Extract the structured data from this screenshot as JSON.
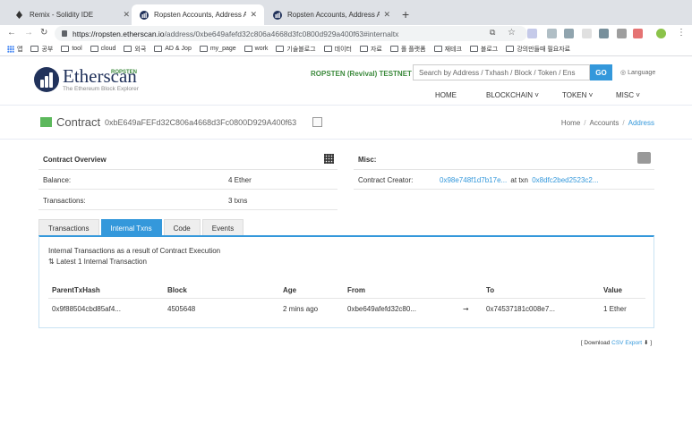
{
  "browser": {
    "tabs": [
      {
        "title": "Remix - Solidity IDE",
        "active": false
      },
      {
        "title": "Ropsten Accounts, Address Ac",
        "active": true
      },
      {
        "title": "Ropsten Accounts, Address Ac",
        "active": false
      }
    ],
    "url_host": "https://ropsten.etherscan.io",
    "url_path": "/address/0xbe649afefd32c806a4668d3fc0800d929a400f63#internaltx",
    "bookmarks": [
      "앱",
      "공부",
      "tool",
      "cloud",
      "외국",
      "AD & Jop",
      "my_page",
      "work",
      "기술블로그",
      "데이터",
      "자료",
      "폴 플랫폼",
      "재테크",
      "블로그",
      "강의만들때 필요자료"
    ]
  },
  "header": {
    "logo_name": "Etherscan",
    "logo_sub": "The Ethereum Block Explorer",
    "logo_network": "ROPSTEN",
    "testnet_label": "ROPSTEN (Revival) TESTNET",
    "search_placeholder": "Search by Address / Txhash / Block / Token / Ens",
    "go_label": "GO",
    "language_label": "Language",
    "menu": [
      "HOME",
      "BLOCKCHAIN ˅",
      "TOKEN ˅",
      "MISC ˅"
    ]
  },
  "page": {
    "title": "Contract",
    "address": "0xbE649aFEFd32C806a4668d3Fc0800D929A400f63",
    "breadcrumb": [
      "Home",
      "Accounts",
      "Address"
    ]
  },
  "overview": {
    "title": "Contract Overview",
    "balance_label": "Balance:",
    "balance_value": "4 Ether",
    "transactions_label": "Transactions:",
    "transactions_value": "3 txns"
  },
  "misc": {
    "title": "Misc:",
    "creator_label": "Contract Creator:",
    "creator_address": "0x98e748f1d7b17e...",
    "at_txn": "at txn",
    "creator_txn": "0x8dfc2bed2523c2..."
  },
  "tabs": [
    "Transactions",
    "Internal Txns",
    "Code",
    "Events"
  ],
  "internal": {
    "note": "Internal Transactions as a result of Contract Execution",
    "latest": "Latest 1 Internal Transaction",
    "columns": [
      "ParentTxHash",
      "Block",
      "Age",
      "From",
      "",
      "To",
      "Value"
    ],
    "rows": [
      {
        "hash": "0x9f88504cbd85af4...",
        "block": "4505648",
        "age": "2 mins ago",
        "from": "0xbe649afefd32c80...",
        "arrow": "➞",
        "to": "0x74537181c008e7...",
        "value": "1 Ether"
      }
    ]
  },
  "download": {
    "prefix": "[ Download",
    "link": "CSV Export",
    "suffix": "⬇ ]"
  }
}
